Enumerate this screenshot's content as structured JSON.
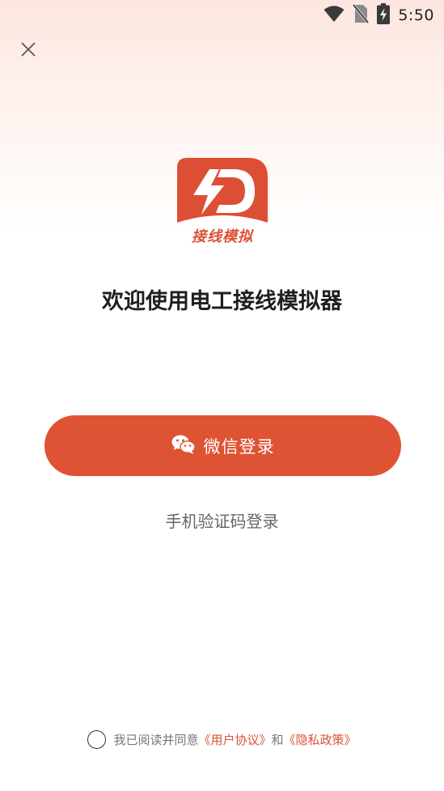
{
  "status_bar": {
    "time": "5:50",
    "icons": [
      "wifi-icon",
      "no-sim-icon",
      "battery-charging-icon"
    ]
  },
  "header": {
    "close_icon": "close-icon"
  },
  "logo": {
    "text": "接线模拟",
    "brand_color": "#dd4f34"
  },
  "main": {
    "title": "欢迎使用电工接线模拟器",
    "wechat_login_label": "微信登录",
    "wechat_icon": "wechat-icon",
    "sms_login_label": "手机验证码登录",
    "button_color": "#df5335"
  },
  "footer": {
    "agree_prefix": "我已阅读并同意",
    "user_agreement": "《用户协议》",
    "conjunction": "和",
    "privacy_policy": "《隐私政策》",
    "link_color": "#d9533a"
  }
}
